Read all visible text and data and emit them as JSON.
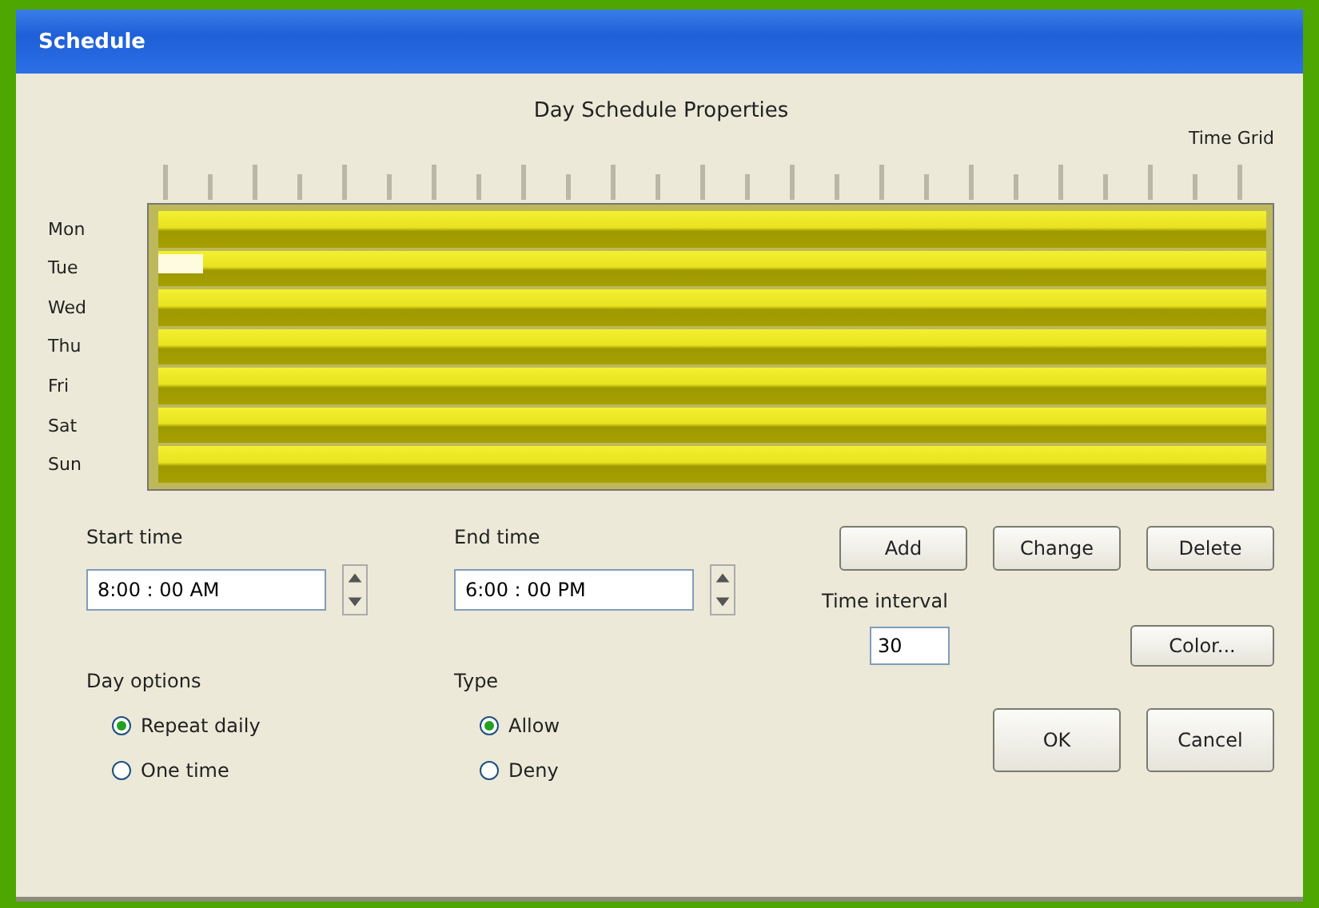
{
  "window": {
    "title": "Schedule"
  },
  "heading": "Day Schedule Properties",
  "corner_note": "Time Grid",
  "days": [
    {
      "label": "Mon",
      "selected": false
    },
    {
      "label": "Tue",
      "selected": true
    },
    {
      "label": "Wed",
      "selected": false
    },
    {
      "label": "Thu",
      "selected": false
    },
    {
      "label": "Fri",
      "selected": false
    },
    {
      "label": "Sat",
      "selected": false
    },
    {
      "label": "Sun",
      "selected": false
    }
  ],
  "start_time": {
    "label": "Start time",
    "value": "8:00 : 00 AM"
  },
  "end_time": {
    "label": "End time",
    "value": "6:00 : 00 PM"
  },
  "actions": [
    "Add",
    "Change",
    "Delete"
  ],
  "interval": {
    "label": "Time interval",
    "value": "30"
  },
  "color_button": "Color...",
  "day_options": {
    "label": "Day options",
    "options": [
      {
        "label": "Repeat daily",
        "selected": true
      },
      {
        "label": "One time",
        "selected": false
      }
    ]
  },
  "type": {
    "label": "Type",
    "options": [
      {
        "label": "Allow",
        "selected": true
      },
      {
        "label": "Deny",
        "selected": false
      }
    ]
  },
  "buttons": [
    "OK",
    "Cancel"
  ]
}
